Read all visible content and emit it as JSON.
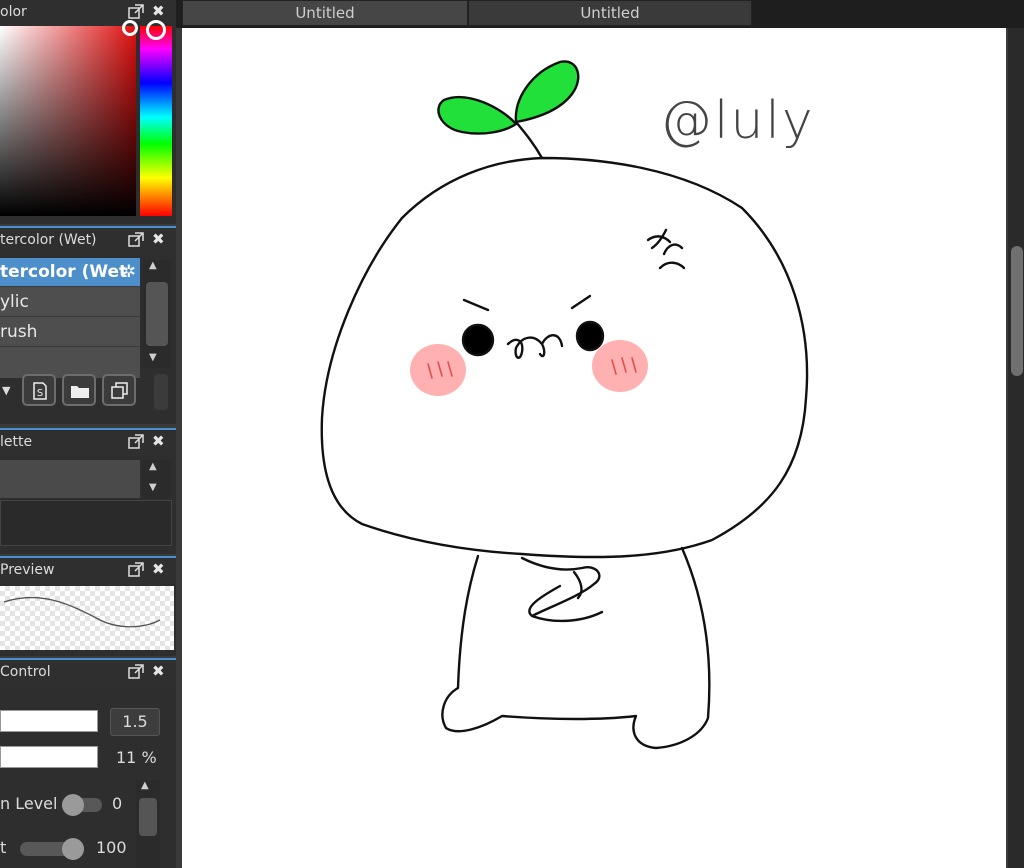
{
  "panels": {
    "color": {
      "title": "olor"
    },
    "brush": {
      "title": "tercolor (Wet)",
      "items": [
        {
          "label": "tercolor (Wet"
        },
        {
          "label": "ylic"
        },
        {
          "label": "rush"
        }
      ]
    },
    "palette": {
      "title": "lette"
    },
    "preview": {
      "title": " Preview"
    },
    "control": {
      "title": " Control",
      "size_value": "1.5",
      "opacity_value": "11 %",
      "level_label": "n Level",
      "level_value": "0",
      "second_label": "t",
      "second_value": "100"
    }
  },
  "tabs": [
    {
      "label": "Untitled"
    },
    {
      "label": "Untitled"
    }
  ],
  "canvas": {
    "signature": "@luly"
  },
  "colors": {
    "accent_blue": "#4d8fcb",
    "sprout_green": "#22e03a",
    "blush_pink": "#ffb0b0"
  }
}
